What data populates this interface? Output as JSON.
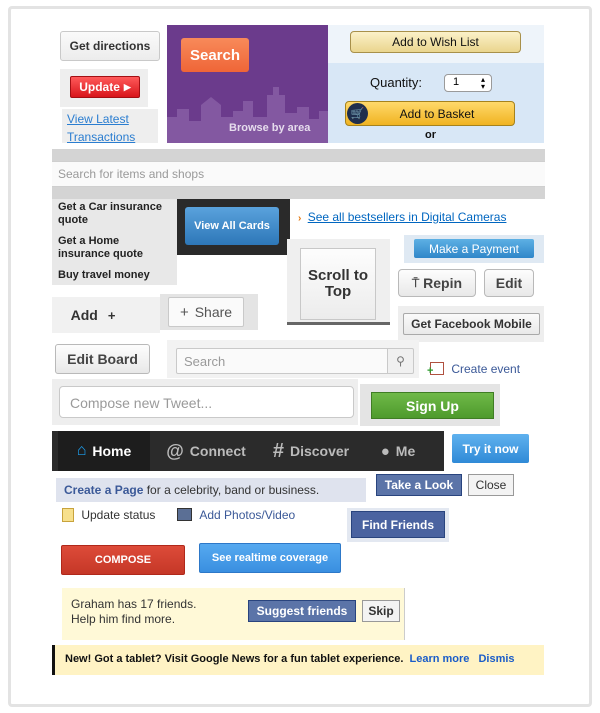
{
  "get_directions": "Get directions",
  "update": "Update",
  "view_latest_transactions": "View Latest Transactions",
  "purple_banner": {
    "search_button": "Search",
    "browse_label": "Browse by area"
  },
  "wish_list": "Add to Wish List",
  "quantity": {
    "label": "Quantity:",
    "value": "1"
  },
  "add_to_basket": "Add to Basket",
  "or_label": "or",
  "shop_search_placeholder": "Search for items and shops",
  "insurance_menu": [
    "Get a Car insurance quote",
    "Get a Home insurance quote",
    "Buy travel money"
  ],
  "view_all_cards": "View All Cards",
  "bestsellers_link": "See all bestsellers in Digital Cameras",
  "make_payment": "Make a Payment",
  "scroll_to_top": "Scroll to Top",
  "repin": "Repin",
  "edit": "Edit",
  "add": "Add",
  "share": "Share",
  "get_facebook_mobile": "Get Facebook Mobile",
  "edit_board": "Edit Board",
  "search_placeholder": "Search",
  "create_event": "Create event",
  "compose_tweet_placeholder": "Compose new Tweet...",
  "sign_up": "Sign Up",
  "twitter_nav": [
    {
      "label": "Home",
      "icon": "house-icon"
    },
    {
      "label": "Connect",
      "icon": "at-icon"
    },
    {
      "label": "Discover",
      "icon": "hash-icon"
    },
    {
      "label": "Me",
      "icon": "person-icon"
    }
  ],
  "try_it_now": "Try it now",
  "create_page": {
    "link": "Create a Page",
    "rest": " for a celebrity, band or business."
  },
  "take_a_look": "Take a Look",
  "close": "Close",
  "update_status": "Update status",
  "add_photos": "Add Photos/Video",
  "find_friends": "Find Friends",
  "compose": "COMPOSE",
  "realtime": "See realtime coverage",
  "friend_prompt": {
    "line1": "Graham has 17 friends.",
    "line2": "Help him find more."
  },
  "suggest_friends": "Suggest friends",
  "skip": "Skip",
  "news_banner": {
    "text": "New! Got a tablet? Visit Google News for a fun tablet experience.",
    "learn_more": "Learn more",
    "dismiss": "Dismis"
  },
  "colors": {
    "orange": "#f26c3a",
    "purple": "#6b3b8c",
    "fb_blue": "#3b5998",
    "twitter_dark": "#2b2b2b",
    "green": "#5aa437",
    "red": "#d24a3a"
  }
}
